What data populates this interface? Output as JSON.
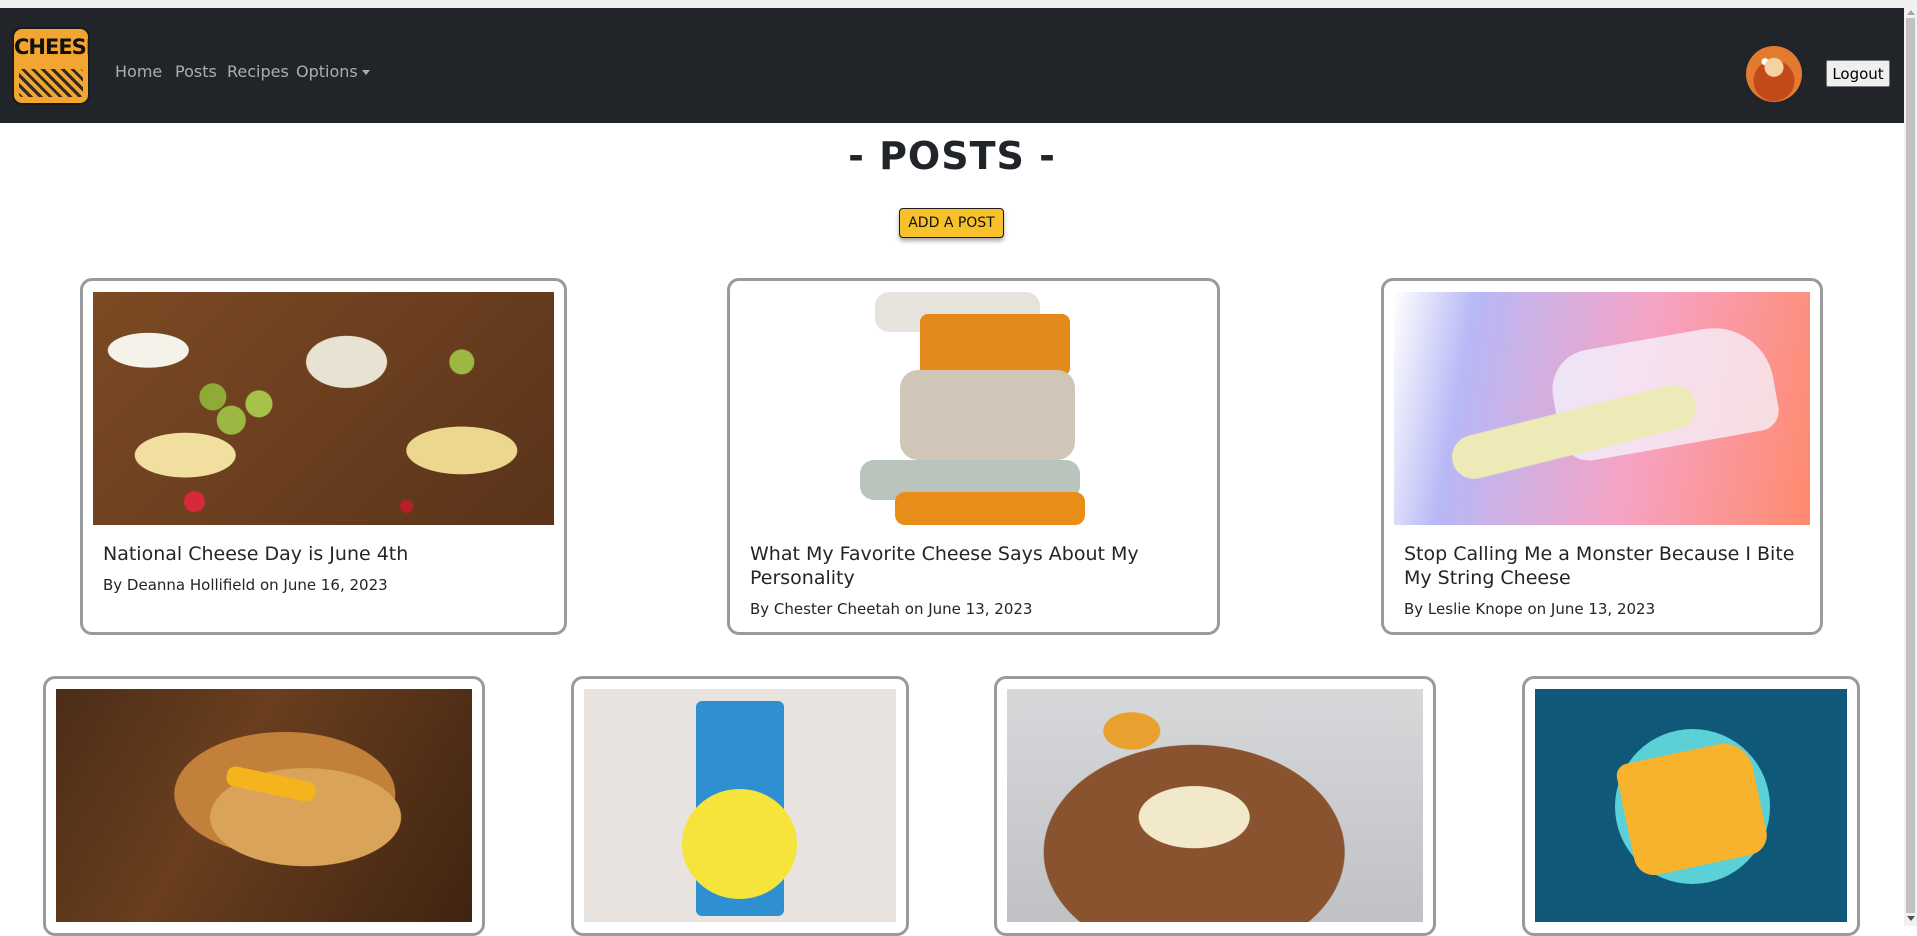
{
  "brand": {
    "logo_text": "CHEESE"
  },
  "nav": {
    "home": "Home",
    "posts": "Posts",
    "recipes": "Recipes",
    "options": "Options"
  },
  "header": {
    "logout_label": "Logout"
  },
  "page": {
    "title": "- POSTS -",
    "add_post_label": "ADD A POST"
  },
  "posts": [
    {
      "title": "National Cheese Day is June 4th",
      "meta": "By Deanna Hollifield on June 16, 2023"
    },
    {
      "title": "What My Favorite Cheese Says About My Personality",
      "meta": "By Chester Cheetah on June 13, 2023"
    },
    {
      "title": "Stop Calling Me a Monster Because I Bite My String Cheese",
      "meta": "By Leslie Knope on June 13, 2023"
    }
  ],
  "images": [
    "cheese-board-image",
    "stacked-cheese-image",
    "string-cheese-image",
    "grilled-cheese-image",
    "lemon-cheese-pie-box-image",
    "cheese-platter-image",
    "swiss-cheese-illustration"
  ],
  "colors": {
    "navbar_bg": "#212529",
    "accent_yellow": "#f6c12a",
    "card_border": "#9a9a9a"
  }
}
